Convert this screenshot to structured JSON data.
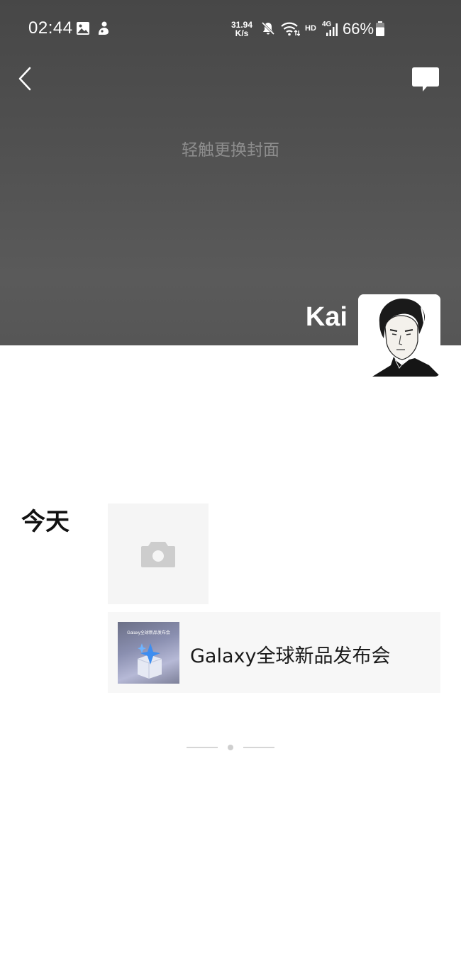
{
  "status_bar": {
    "time": "02:44",
    "net_speed_value": "31.94",
    "net_speed_unit": "K/s",
    "hd_label": "HD",
    "network_label": "4G",
    "battery_percent": "66%",
    "icons": [
      "gallery-icon",
      "app-notification-icon",
      "mute-icon",
      "wifi-icon",
      "signal-icon",
      "battery-icon"
    ]
  },
  "header": {
    "back_icon": "chevron-left-icon",
    "message_icon": "message-icon"
  },
  "cover": {
    "hint": "轻触更换封面"
  },
  "profile": {
    "name": "Kai"
  },
  "timeline": {
    "day_label": "今天",
    "add_photo_icon": "camera-icon",
    "share": {
      "title": "Galaxy全球新品发布会",
      "thumbnail_text": "Galaxy全球新品发布会"
    }
  },
  "colors": {
    "cover_bg": "#505050",
    "hint_text": "#8d8d8d",
    "card_bg": "#f7f7f7"
  }
}
